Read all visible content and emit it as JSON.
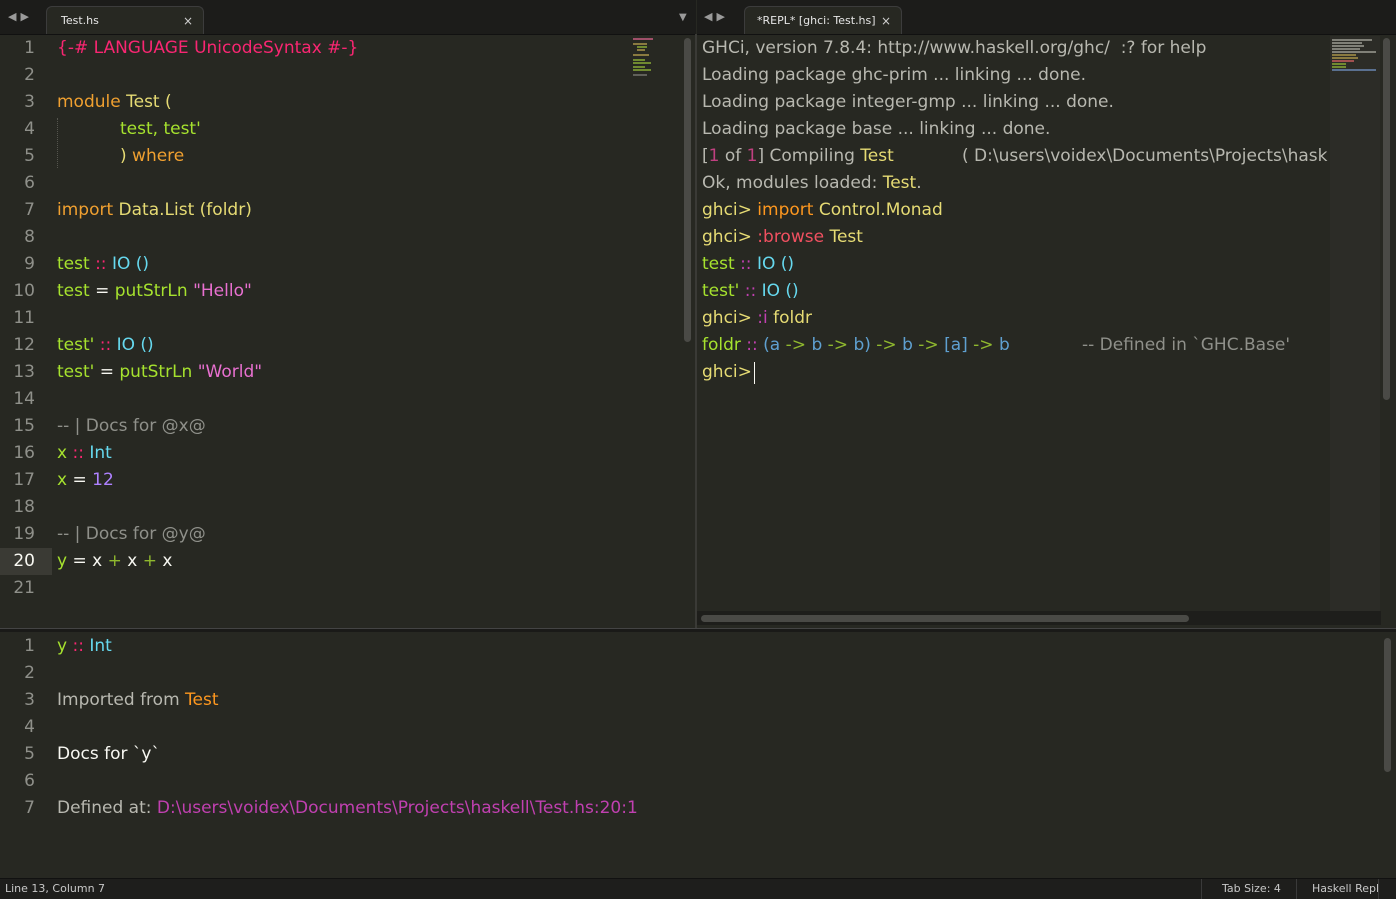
{
  "left_tab": {
    "title": "Test.hs",
    "close": "×"
  },
  "right_tab": {
    "title": "*REPL* [ghci: Test.hs]",
    "close": "×"
  },
  "nav": {
    "back": "◀",
    "forward": "▶",
    "menu": "▼"
  },
  "editor_lines": [
    {
      "n": "1"
    },
    {
      "n": "2"
    },
    {
      "n": "3"
    },
    {
      "n": "4"
    },
    {
      "n": "5"
    },
    {
      "n": "6"
    },
    {
      "n": "7"
    },
    {
      "n": "8"
    },
    {
      "n": "9"
    },
    {
      "n": "10"
    },
    {
      "n": "11"
    },
    {
      "n": "12"
    },
    {
      "n": "13"
    },
    {
      "n": "14"
    },
    {
      "n": "15"
    },
    {
      "n": "16"
    },
    {
      "n": "17"
    },
    {
      "n": "18"
    },
    {
      "n": "19"
    },
    {
      "n": "20"
    },
    {
      "n": "21"
    }
  ],
  "editor_code": {
    "l1": "{-# LANGUAGE UnicodeSyntax #-}",
    "l3_kw": "module",
    "l3_name": "Test",
    "l3_paren": "(",
    "l4": "test, test'",
    "l5_paren": ")",
    "l5_kw": "where",
    "l7_kw": "import",
    "l7_mod": "Data.List",
    "l7_rest": "(foldr)",
    "l9_name": "test",
    "l9_op": "::",
    "l9_type": "IO ()",
    "l10_name": "test",
    "l10_eq": "=",
    "l10_fn": "putStrLn",
    "l10_str": "\"Hello\"",
    "l12_name": "test'",
    "l12_op": "::",
    "l12_type": "IO ()",
    "l13_name": "test'",
    "l13_eq": "=",
    "l13_fn": "putStrLn",
    "l13_str": "\"World\"",
    "l15": "-- | Docs for @x@",
    "l16_name": "x",
    "l16_op": "::",
    "l16_type": "Int",
    "l17_name": "x",
    "l17_eq": "=",
    "l17_num": "12",
    "l19": "-- | Docs for @y@",
    "l20_y": "y",
    "l20_eq": "=",
    "l20_x1": "x",
    "l20_p1": "+",
    "l20_x2": "x",
    "l20_p2": "+",
    "l20_x3": "x"
  },
  "repl": {
    "l1": "GHCi, version 7.8.4: http://www.haskell.org/ghc/  :? for help",
    "l2": "Loading package ghc-prim ... linking ... done.",
    "l3": "Loading package integer-gmp ... linking ... done.",
    "l4": "Loading package base ... linking ... done.",
    "l5_a": "[",
    "l5_b": "1",
    "l5_c": " of ",
    "l5_d": "1",
    "l5_e": "] Compiling ",
    "l5_f": "Test",
    "l5_g": "( D:\\users\\voidex\\Documents\\Projects\\hask",
    "l6_a": "Ok, modules loaded: ",
    "l6_b": "Test",
    "l6_c": ".",
    "l7_prompt": "ghci>",
    "l7_kw": "import",
    "l7_mod": "Control.Monad",
    "l8_prompt": "ghci>",
    "l8_cmd": ":browse",
    "l8_mod": "Test",
    "l9_name": "test",
    "l9_op": "::",
    "l9_type": "IO ()",
    "l10_name": "test'",
    "l10_op": "::",
    "l10_type": "IO ()",
    "l11_prompt": "ghci>",
    "l11_cmd": ":i",
    "l11_arg": "foldr",
    "l12_name": "foldr",
    "l12_op": "::",
    "l12_sig": [
      "(a",
      "->",
      "b",
      "->",
      "b)",
      "->",
      "b",
      "->",
      "[a]",
      "->",
      "b"
    ],
    "l12_cm": "-- Defined in `GHC.Base'",
    "l13_prompt": "ghci>"
  },
  "docs_lines": [
    {
      "n": "1"
    },
    {
      "n": "2"
    },
    {
      "n": "3"
    },
    {
      "n": "4"
    },
    {
      "n": "5"
    },
    {
      "n": "6"
    },
    {
      "n": "7"
    }
  ],
  "docs": {
    "l1_name": "y",
    "l1_op": "::",
    "l1_type": "Int",
    "l3_a": "Imported from ",
    "l3_b": "Test",
    "l5": "Docs for `y`",
    "l7_a": "Defined at: ",
    "l7_b": "D:\\users\\voidex\\Documents\\Projects\\haskell\\Test.hs:20:1"
  },
  "status": {
    "position": "Line 13, Column 7",
    "tab_size": "Tab Size: 4",
    "syntax": "Haskell Repl"
  },
  "colors": {
    "background": "#272822",
    "keyword": "#f0a030",
    "string": "#e870d0",
    "comment": "#8f908a"
  }
}
